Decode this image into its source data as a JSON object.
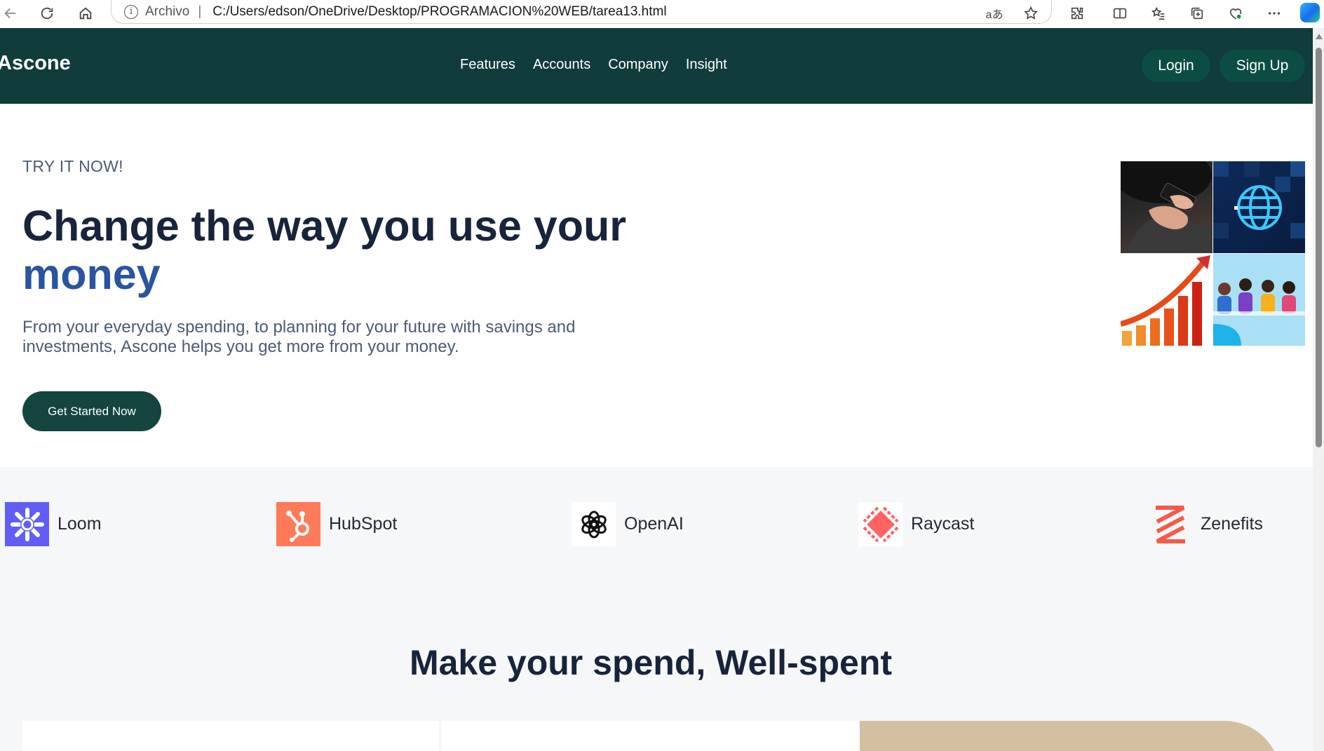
{
  "browser": {
    "address_scheme": "Archivo",
    "address_separator": "|",
    "url": "C:/Users/edson/OneDrive/Desktop/PROGRAMACION%20WEB/tarea13.html",
    "info_symbol": "i",
    "read_aloud_symbol": "aあ"
  },
  "nav": {
    "logo": "Ascone",
    "links": [
      "Features",
      "Accounts",
      "Company",
      "Insight"
    ],
    "login": "Login",
    "signup": "Sign Up"
  },
  "hero": {
    "eyebrow": "TRY IT NOW!",
    "headline": "Change the way you use your",
    "headline_accent": "money",
    "lead": "From your everyday spending, to planning for your future with savings and investments, Ascone helps you get more from your money.",
    "cta": "Get Started Now"
  },
  "brands": [
    "Loom",
    "HubSpot",
    "OpenAI",
    "Raycast",
    "Zenefits"
  ],
  "section": {
    "title": "Make your spend, Well-spent"
  },
  "colors": {
    "nav_bg": "#103c3b",
    "button_bg": "#0c4d43",
    "headline": "#18243b",
    "accent": "#2a54a0",
    "loom": "#625df5",
    "hubspot": "#ff7a59",
    "raycast": "#ff6363",
    "zenefits": "#f45b4a"
  }
}
